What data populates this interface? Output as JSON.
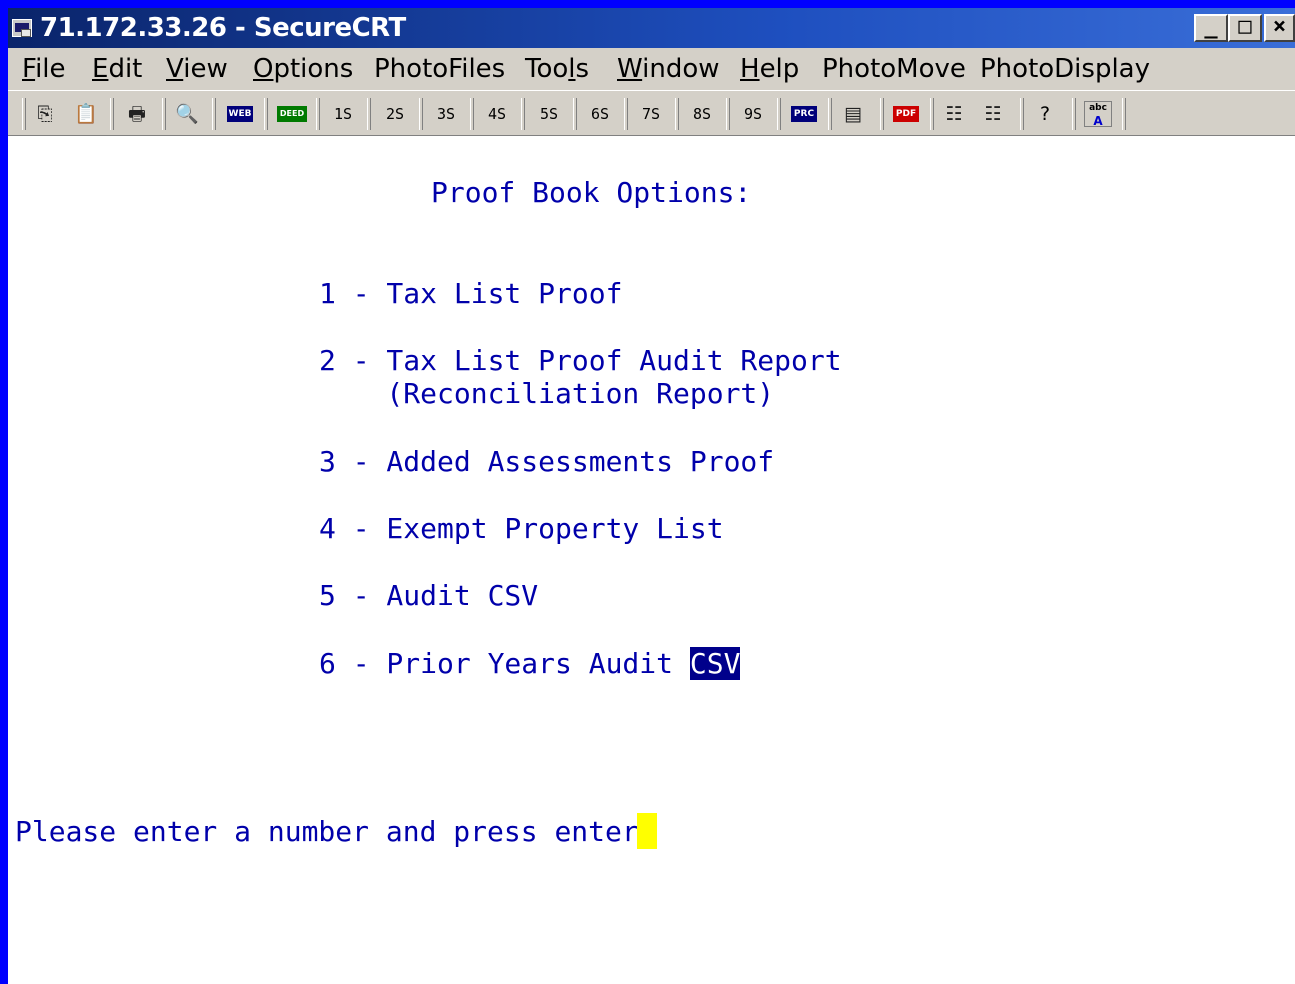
{
  "window": {
    "title": "71.172.33.26 - SecureCRT",
    "controls": {
      "minimize": "_",
      "maximize": "□",
      "close": "×"
    }
  },
  "menu": [
    {
      "pre": "",
      "ul": "F",
      "post": "ile"
    },
    {
      "pre": "",
      "ul": "E",
      "post": "dit"
    },
    {
      "pre": "",
      "ul": "V",
      "post": "iew"
    },
    {
      "pre": "",
      "ul": "O",
      "post": "ptions"
    },
    {
      "pre": "PhotoFiles",
      "ul": "",
      "post": ""
    },
    {
      "pre": "Too",
      "ul": "l",
      "post": "s"
    },
    {
      "pre": "",
      "ul": "W",
      "post": "indow"
    },
    {
      "pre": "",
      "ul": "H",
      "post": "elp"
    },
    {
      "pre": "PhotoMove",
      "ul": "",
      "post": ""
    },
    {
      "pre": "PhotoDisplay",
      "ul": "",
      "post": ""
    }
  ],
  "toolbar": {
    "web": "WEB",
    "deed": "DEED",
    "sessions": [
      "1S",
      "2S",
      "3S",
      "4S",
      "5S",
      "6S",
      "7S",
      "8S",
      "9S"
    ],
    "prc": "PRC",
    "pdf": "PDF",
    "abc": "abc"
  },
  "terminal": {
    "heading": "Proof Book Options:",
    "options": [
      "1 - Tax List Proof",
      "2 - Tax List Proof Audit Report",
      "    (Reconciliation Report)",
      "3 - Added Assessments Proof",
      "4 - Exempt Property List",
      "5 - Audit CSV",
      "6 - Prior Years Audit "
    ],
    "option6_highlight": "CSV",
    "prompt": "Please enter a number and press enter: "
  }
}
